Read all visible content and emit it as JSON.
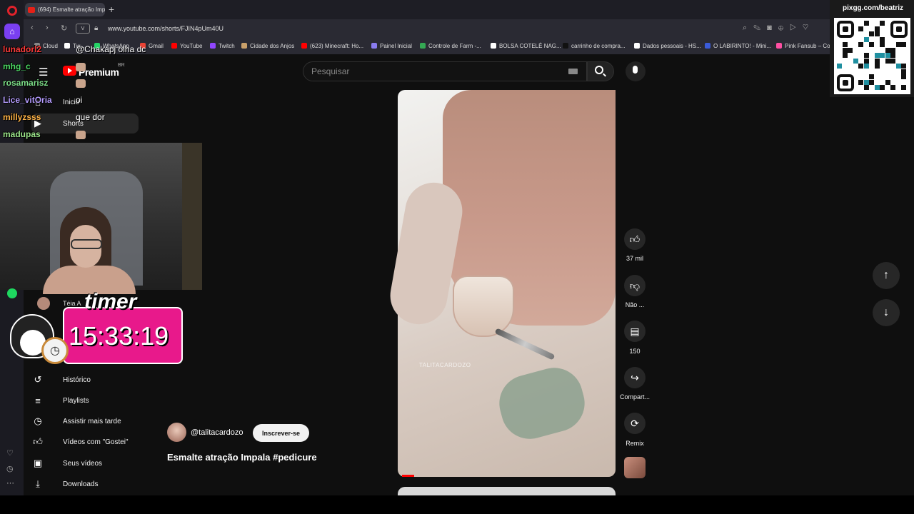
{
  "browser": {
    "tab_title": "(694) Esmalte atração Imp",
    "new_tab": "+",
    "url": "www.youtube.com/shorts/FJIN4pUm40U",
    "url_box": "V",
    "bookmarks": [
      {
        "label": "Cloud",
        "color": "#888888"
      },
      {
        "label": "Tw...",
        "color": "#ffffff"
      },
      {
        "label": "WhatsApp",
        "color": "#25d366"
      },
      {
        "label": "Gmail",
        "color": "#ea4335"
      },
      {
        "label": "YouTube",
        "color": "#ff0000"
      },
      {
        "label": "Twitch",
        "color": "#9146ff"
      },
      {
        "label": "Cidade dos Anjos",
        "color": "#c9a06a"
      },
      {
        "label": "(623) Minecraft: Ho...",
        "color": "#ff0000"
      },
      {
        "label": "Painel Inicial",
        "color": "#8a7cf0"
      },
      {
        "label": "Controle de Farm -...",
        "color": "#34a853"
      },
      {
        "label": "BOLSA COTELÊ NAG...",
        "color": "#ffffff"
      },
      {
        "label": "carrinho de compra...",
        "color": "#111111"
      },
      {
        "label": "Dados pessoais - HS...",
        "color": "#ffffff"
      },
      {
        "label": "O LABIRINTO! - Mini...",
        "color": "#3a5bd9"
      },
      {
        "label": "Pink Fansub – Co",
        "color": "#ff4fa3"
      }
    ]
  },
  "youtube": {
    "premium_label": "Premium",
    "country": "BR",
    "search_placeholder": "Pesquisar",
    "nav": {
      "home": "Inicio",
      "shorts": "Shorts",
      "history": "Histórico",
      "playlists": "Playlists",
      "watch_later": "Assistir mais tarde",
      "liked": "Vídeos com \"Gostei\"",
      "your_videos": "Seus vídeos",
      "downloads": "Downloads"
    },
    "short": {
      "watermark": "TALITACARDOZO",
      "channel": "@talitacardozo",
      "subscribe": "Inscrever-se",
      "title": "Esmalte atração Impala #pedicure"
    },
    "actions": {
      "likes": "37 mil",
      "dislike": "Não ...",
      "comments": "150",
      "share": "Compart...",
      "remix": "Remix"
    },
    "lower_channel_name": "Téia A"
  },
  "overlay": {
    "qr_label": "pixgg.com/beatriz",
    "chat": [
      {
        "name": "lunadorl2",
        "color": "#ff3b3b",
        "message": "@Chakapj olha dc"
      },
      {
        "name": "mhg_c",
        "color": "#4cd964",
        "message": ""
      },
      {
        "name": "rosamarisz",
        "color": "#7ee08a",
        "message": ""
      },
      {
        "name": "Lice_vitOria",
        "color": "#b59cff",
        "message": "oi"
      },
      {
        "name": "millyzsss",
        "color": "#ffb347",
        "message": "que dor"
      },
      {
        "name": "madupas",
        "color": "#9be58a",
        "message": ""
      }
    ],
    "timer_title": "timer",
    "timer_value": "15:33:19"
  }
}
